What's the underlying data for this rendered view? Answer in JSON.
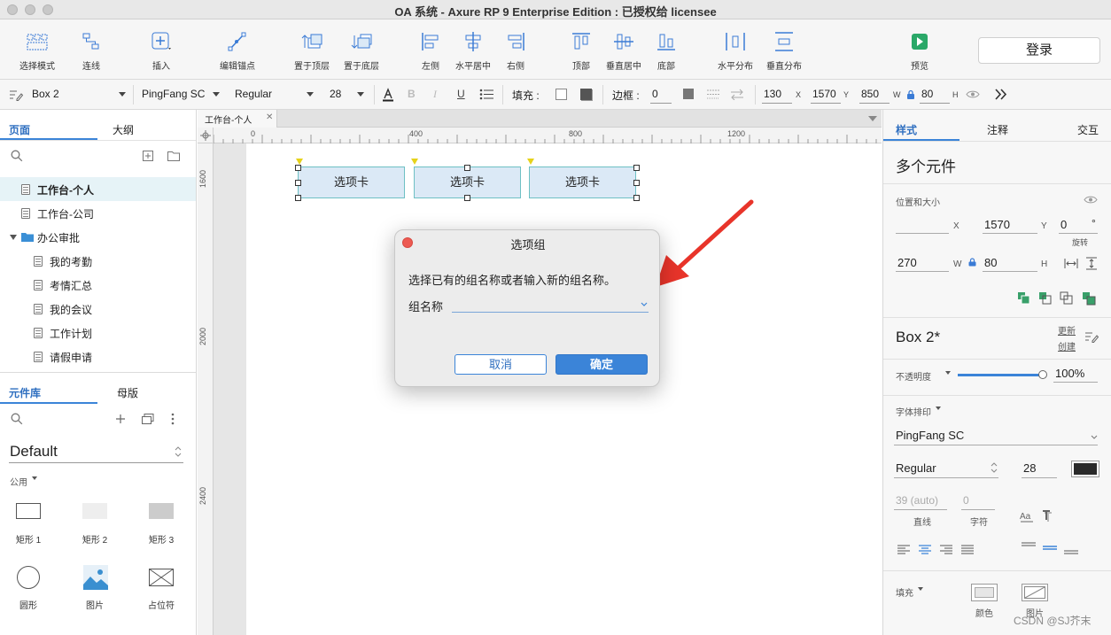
{
  "window": {
    "title": "OA 系统 - Axure RP 9 Enterprise Edition : 已授权给 licensee"
  },
  "toolbar": {
    "tools": [
      "选择模式",
      "连线",
      "插入",
      "编辑锚点",
      "置于顶层",
      "置于底层",
      "左侧",
      "水平居中",
      "右侧",
      "顶部",
      "垂直居中",
      "底部",
      "水平分布",
      "垂直分布",
      "预览"
    ],
    "login": "登录"
  },
  "format": {
    "element_name": "Box 2",
    "font_family": "PingFang SC",
    "font_style": "Regular",
    "font_size": "28",
    "fill_label": "填充 :",
    "border_label": "边框 :",
    "border_value": "0",
    "x": "130",
    "x_label": "X",
    "y": "1570",
    "y_label": "Y",
    "w": "850",
    "w_label": "W",
    "h": "80",
    "h_label": "H"
  },
  "left": {
    "tabs": [
      "页面",
      "大纲"
    ],
    "pages": [
      {
        "label": "工作台-个人",
        "selected": true,
        "folder": false,
        "indent": 0
      },
      {
        "label": "工作台-公司",
        "selected": false,
        "folder": false,
        "indent": 0
      },
      {
        "label": "办公审批",
        "selected": false,
        "folder": true,
        "indent": 0
      },
      {
        "label": "我的考勤",
        "selected": false,
        "folder": false,
        "indent": 1
      },
      {
        "label": "考情汇总",
        "selected": false,
        "folder": false,
        "indent": 1
      },
      {
        "label": "我的会议",
        "selected": false,
        "folder": false,
        "indent": 1
      },
      {
        "label": "工作计划",
        "selected": false,
        "folder": false,
        "indent": 1
      },
      {
        "label": "请假申请",
        "selected": false,
        "folder": false,
        "indent": 1
      }
    ],
    "lib_tabs": [
      "元件库",
      "母版"
    ],
    "library": "Default",
    "category": "公用",
    "widgets": [
      "矩形 1",
      "矩形 2",
      "矩形 3",
      "圆形",
      "图片",
      "占位符"
    ]
  },
  "canvas": {
    "doc_tab": "工作台-个人",
    "hruler": [
      "0",
      "400",
      "800",
      "1200"
    ],
    "vruler": [
      "1600",
      "2000",
      "2400"
    ],
    "tabs": [
      "选项卡",
      "选项卡",
      "选项卡"
    ]
  },
  "dialog": {
    "title": "选项组",
    "message": "选择已有的组名称或者输入新的组名称。",
    "field_label": "组名称",
    "cancel": "取消",
    "ok": "确定"
  },
  "right": {
    "tabs": [
      "样式",
      "注释",
      "交互"
    ],
    "heading": "多个元件",
    "pos_size": "位置和大小",
    "x_label": "X",
    "y_value": "1570",
    "y_label": "Y",
    "rotation": "0",
    "deg": "°",
    "rotation_label": "旋转",
    "w_value": "270",
    "w_label": "W",
    "h_value": "80",
    "h_label": "H",
    "style_name": "Box 2*",
    "update": "更新",
    "create": "创建",
    "opacity_label": "不透明度",
    "opacity": "100%",
    "opacity_fraction": 1.0,
    "typography": "字体排印",
    "font_family": "PingFang SC",
    "font_style": "Regular",
    "font_size": "28",
    "line_height": "39 (auto)",
    "line_label": "直线",
    "char_spacing": "0",
    "char_label": "字符",
    "fill_label": "填充",
    "fill_color": "颜色",
    "fill_image": "图片"
  },
  "watermark": "CSDN @SJ芥末",
  "colors": {
    "accent": "#3b84d8",
    "tab_fill": "#dbe9f6",
    "tab_border": "#6ec0c4",
    "arrow": "#e8342a",
    "close": "#ed5a52"
  }
}
